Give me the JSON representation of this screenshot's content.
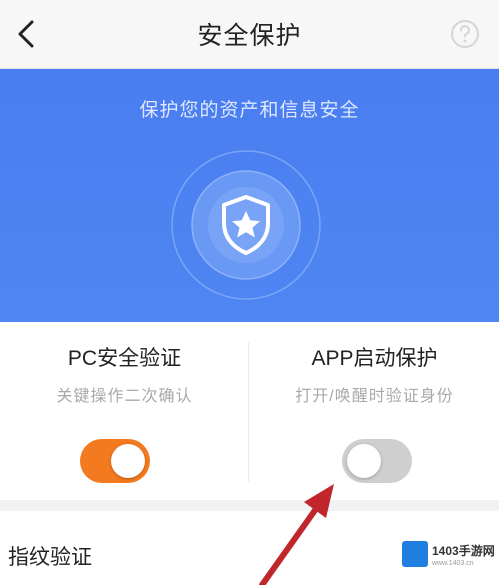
{
  "header": {
    "title": "安全保护",
    "back_icon": "chevron-left-icon",
    "help_icon": "question-circle-icon"
  },
  "hero": {
    "text": "保护您的资产和信息安全",
    "icon": "shield-star-icon",
    "bg_color": "#4f86f2"
  },
  "options": [
    {
      "title": "PC安全验证",
      "subtitle": "关键操作二次确认",
      "enabled": true,
      "toggle_color": "#f47a1f"
    },
    {
      "title": "APP启动保护",
      "subtitle": "打开/唤醒时验证身份",
      "enabled": false,
      "toggle_color": "#cfcfcf"
    }
  ],
  "fingerprint_row": {
    "label": "指纹验证"
  },
  "watermark": {
    "text": "1403手游网",
    "url": "www.1403.cn"
  }
}
